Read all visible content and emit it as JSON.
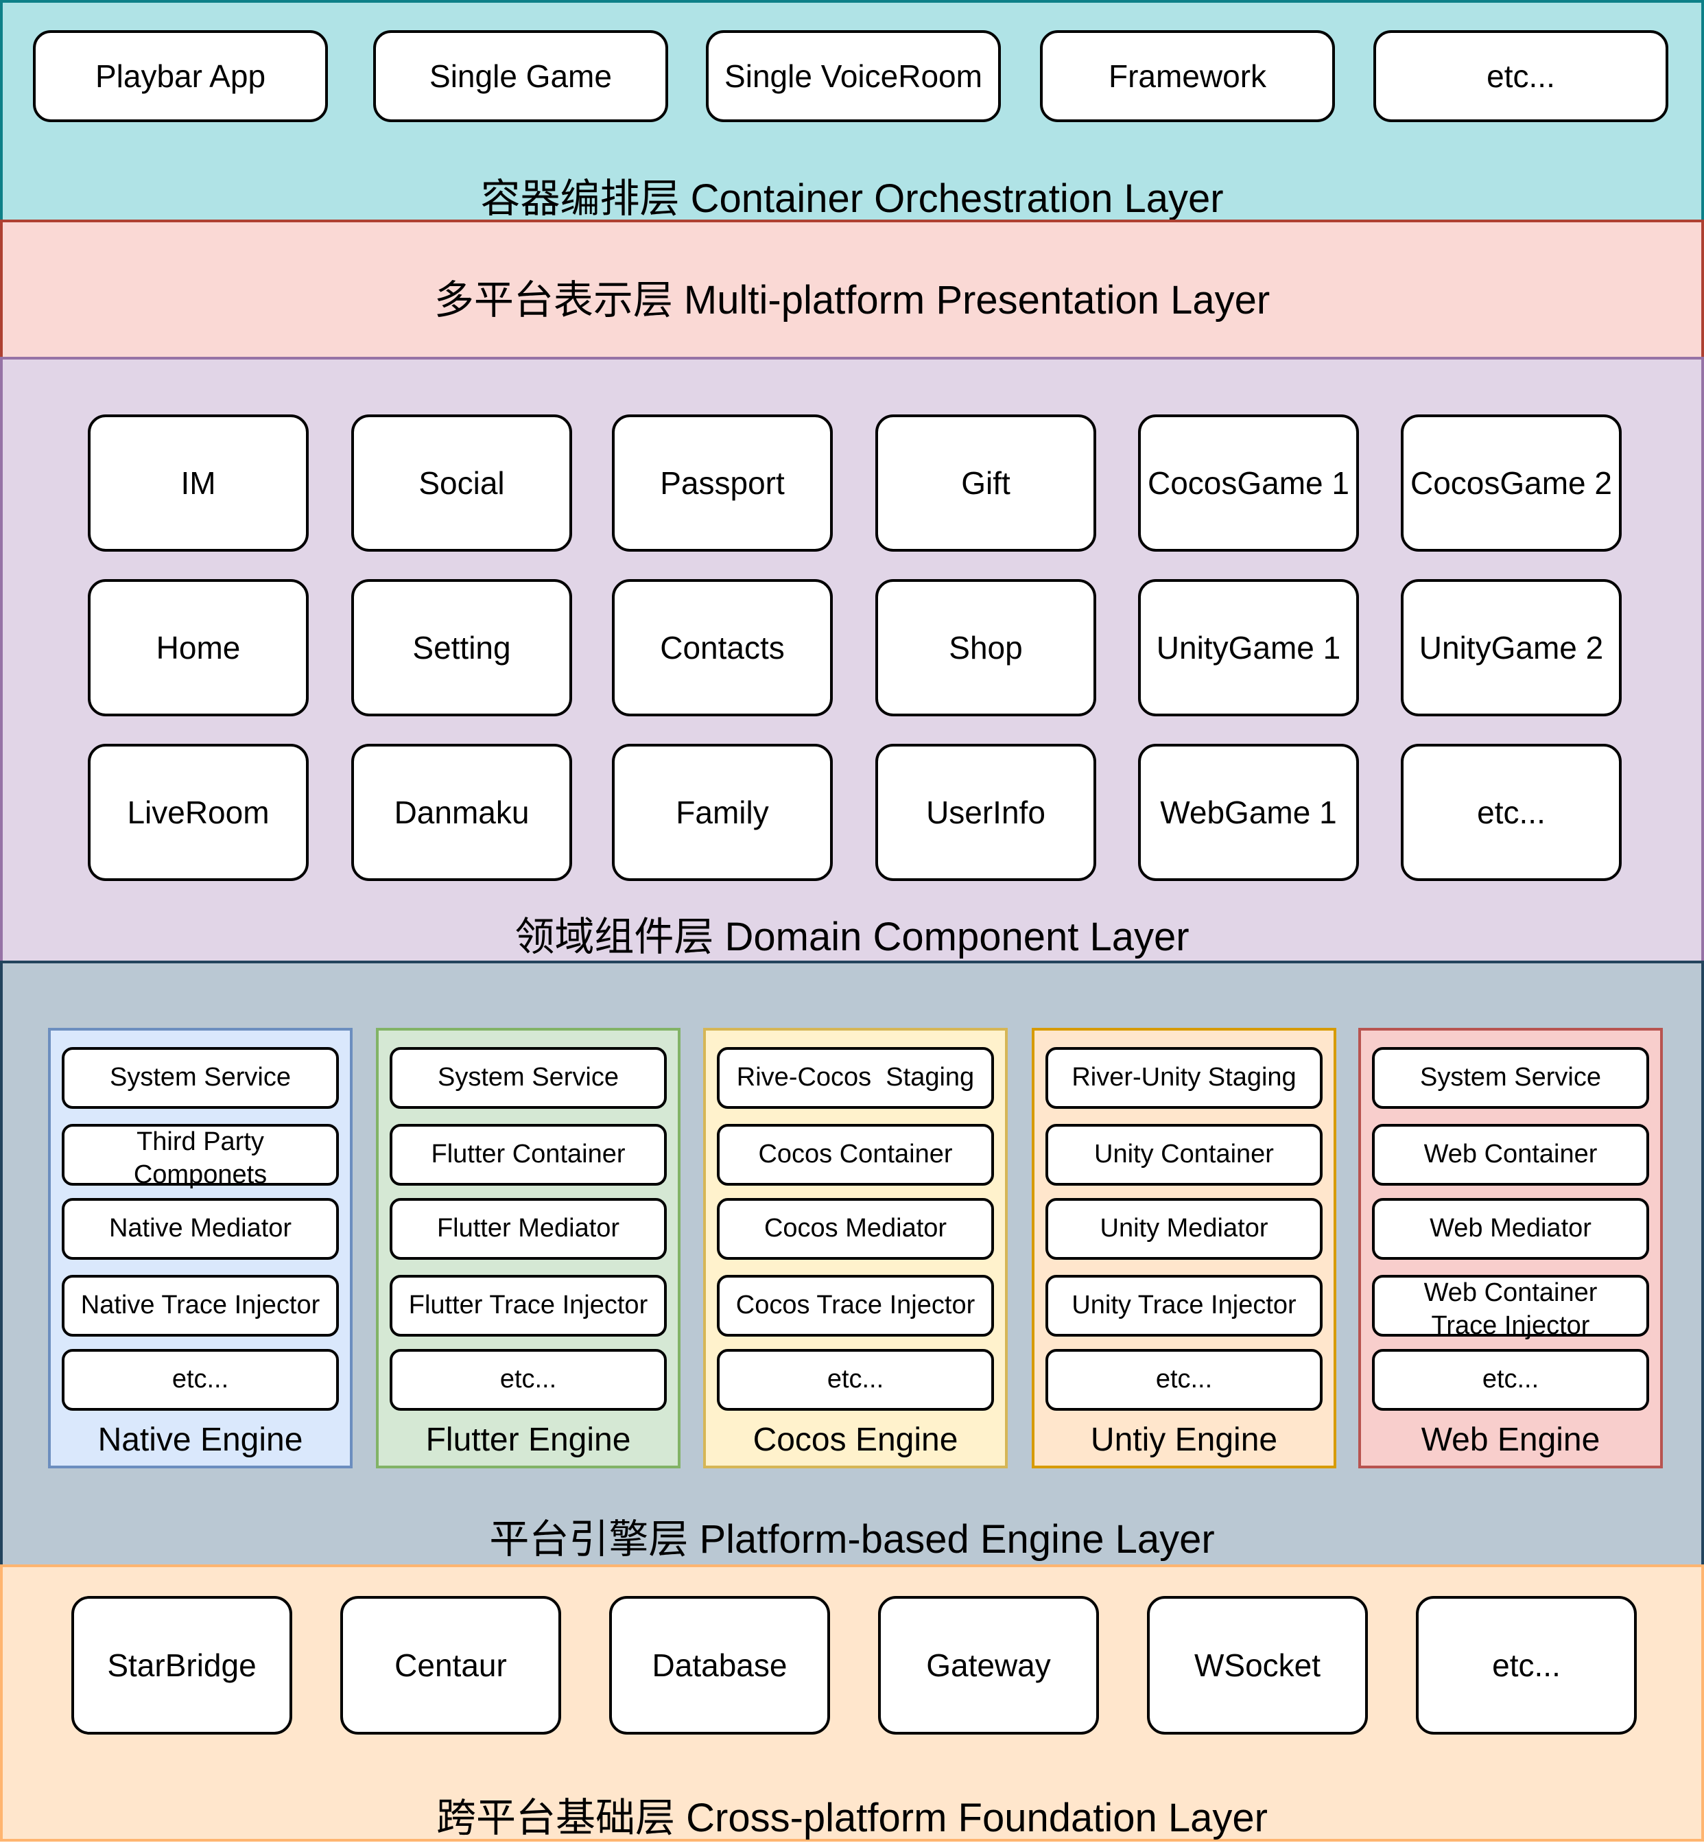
{
  "colors": {
    "orchestration_bg": "#b0e3e6",
    "orchestration_border": "#0e8088",
    "presentation_bg": "#fad9d5",
    "presentation_border": "#ae4132",
    "domain_bg": "#e1d5e7",
    "domain_border": "#9673a6",
    "engine_layer_bg": "#bac8d3",
    "engine_layer_border": "#23445d",
    "foundation_bg": "#ffe6cc",
    "foundation_border": "#ffb570",
    "native_bg": "#dae8fc",
    "native_border": "#6c8ebf",
    "flutter_bg": "#d5e8d4",
    "flutter_border": "#82b366",
    "cocos_bg": "#fff2cc",
    "cocos_border": "#d6b656",
    "unity_bg": "#ffe6cc",
    "unity_border": "#d79b00",
    "web_bg": "#f8cecc",
    "web_border": "#b85450"
  },
  "orchestration": {
    "title": "容器编排层 Container Orchestration Layer",
    "items": [
      "Playbar App",
      "Single Game",
      "Single VoiceRoom",
      "Framework",
      "etc..."
    ]
  },
  "presentation": {
    "title": "多平台表示层 Multi-platform Presentation Layer"
  },
  "domain": {
    "title": "领域组件层 Domain Component Layer",
    "rows": [
      [
        "IM",
        "Social",
        "Passport",
        "Gift",
        "CocosGame 1",
        "CocosGame 2"
      ],
      [
        "Home",
        "Setting",
        "Contacts",
        "Shop",
        "UnityGame 1",
        "UnityGame 2"
      ],
      [
        "LiveRoom",
        "Danmaku",
        "Family",
        "UserInfo",
        "WebGame 1",
        "etc..."
      ]
    ]
  },
  "engine_layer": {
    "title": "平台引擎层 Platform-based Engine Layer",
    "engines": [
      {
        "name": "Native Engine",
        "items": [
          "System Service",
          "Third Party Componets",
          "Native Mediator",
          "Native Trace Injector",
          "etc..."
        ]
      },
      {
        "name": "Flutter Engine",
        "items": [
          "System Service",
          "Flutter Container",
          "Flutter Mediator",
          "Flutter Trace Injector",
          "etc..."
        ]
      },
      {
        "name": "Cocos Engine",
        "items": [
          "Rive-Cocos  Staging",
          "Cocos Container",
          "Cocos Mediator",
          "Cocos Trace Injector",
          "etc..."
        ]
      },
      {
        "name": "Untiy Engine",
        "items": [
          "River-Unity Staging",
          "Unity Container",
          "Unity Mediator",
          "Unity Trace Injector",
          "etc..."
        ]
      },
      {
        "name": "Web Engine",
        "items": [
          "System Service",
          "Web Container",
          "Web Mediator",
          "Web Container Trace Injector",
          "etc..."
        ]
      }
    ]
  },
  "foundation": {
    "title": "跨平台基础层 Cross-platform Foundation Layer",
    "items": [
      "StarBridge",
      "Centaur",
      "Database",
      "Gateway",
      "WSocket",
      "etc..."
    ]
  }
}
